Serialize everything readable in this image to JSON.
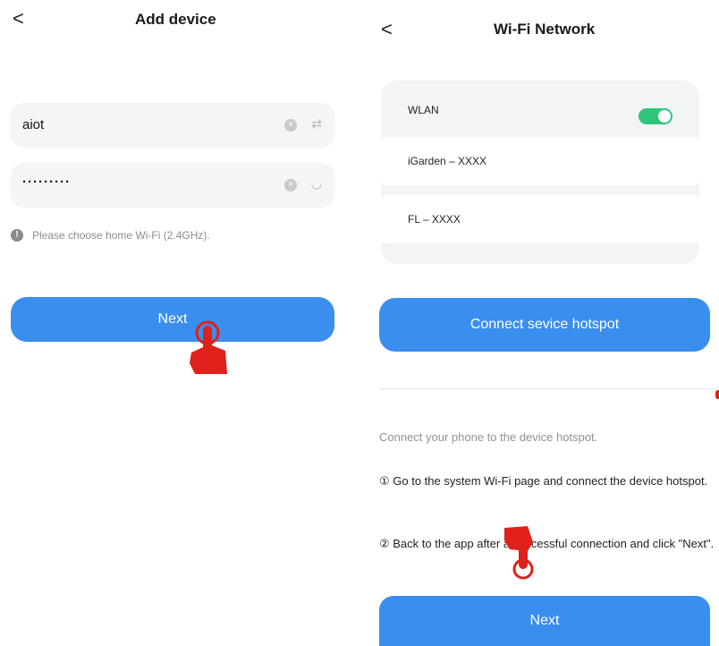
{
  "left": {
    "title": "Add device",
    "back": "<",
    "ssid_value": "aiot",
    "password_value": "·········",
    "clear_glyph": "×",
    "swap_glyph": "⇄",
    "eye_glyph": "◡",
    "hint": "Please choose home Wi-Fi (2.4GHz).",
    "next_label": "Next"
  },
  "right": {
    "title": "Wi-Fi Network",
    "back": "<",
    "networks": [
      "WLAN",
      "iGarden – XXXX",
      "FL – XXXX"
    ],
    "wlan_on": true,
    "connect_label": "Connect sevice hotspot",
    "subtitle": "Connect your phone to the device hotspot.",
    "step1": "① Go to the system Wi-Fi page and connect the device hotspot.",
    "step2": "② Back to the app after a successful connection and click \"Next\".",
    "next_label": "Next"
  },
  "colors": {
    "primary": "#3a8eed",
    "toggle_on": "#2ec57a",
    "hand": "#e0201a",
    "field_bg": "#f4f5f7"
  },
  "icons": [
    "back-chevron-icon",
    "clear-icon",
    "swap-icon",
    "eye-closed-icon",
    "info-icon",
    "pointing-hand-icon"
  ]
}
